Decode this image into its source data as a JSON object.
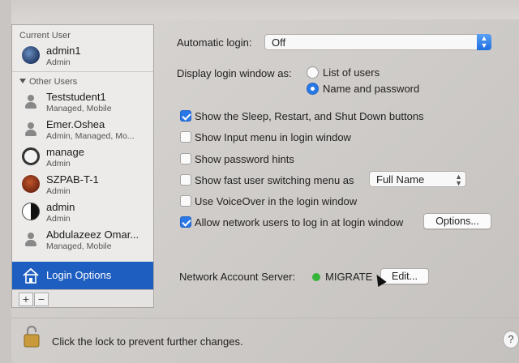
{
  "sidebar": {
    "current_user_title": "Current User",
    "current_user": {
      "name": "admin1",
      "role": "Admin"
    },
    "other_users_title": "Other Users",
    "other_users": [
      {
        "name": "Teststudent1",
        "role": "Managed, Mobile"
      },
      {
        "name": "Emer.Oshea",
        "role": "Admin, Managed, Mo..."
      },
      {
        "name": "manage",
        "role": "Admin"
      },
      {
        "name": "SZPAB-T-1",
        "role": "Admin"
      },
      {
        "name": "admin",
        "role": "Admin"
      },
      {
        "name": "Abdulazeez Omar...",
        "role": "Managed, Mobile"
      }
    ],
    "login_options_label": "Login Options",
    "add_label": "+",
    "remove_label": "−"
  },
  "main": {
    "automatic_login_label": "Automatic login:",
    "automatic_login_value": "Off",
    "display_login_label": "Display login window as:",
    "radio_list_users": "List of users",
    "radio_name_password": "Name and password",
    "selected_display_mode": "Name and password",
    "checkboxes": {
      "sleep_restart": {
        "label": "Show the Sleep, Restart, and Shut Down buttons",
        "checked": true
      },
      "input_menu": {
        "label": "Show Input menu in login window",
        "checked": false
      },
      "password_hints": {
        "label": "Show password hints",
        "checked": false
      },
      "fast_switching": {
        "label": "Show fast user switching menu as",
        "checked": false
      },
      "voiceover": {
        "label": "Use VoiceOver in the login window",
        "checked": false
      },
      "network_users": {
        "label": "Allow network users to log in at login window",
        "checked": true
      }
    },
    "fast_switching_value": "Full Name",
    "options_button": "Options...",
    "network_server_label": "Network Account Server:",
    "network_server_value": "MIGRATE",
    "network_server_status_color": "#35b43a",
    "edit_button": "Edit..."
  },
  "footer": {
    "lock_text": "Click the lock to prevent further changes.",
    "help_label": "?"
  },
  "colors": {
    "accent": "#2a78e6",
    "selection": "#1f5ec1"
  }
}
